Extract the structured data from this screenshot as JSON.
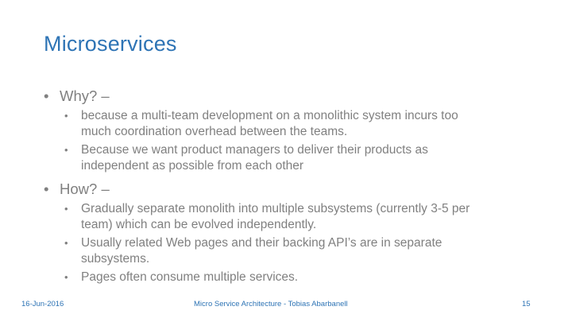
{
  "title": "Microservices",
  "sections": [
    {
      "heading": "Why? –",
      "items": [
        "because a multi-team development on a monolithic system incurs too much coordination overhead between the teams.",
        "Because we want product managers to deliver their products as independent as possible from each other"
      ]
    },
    {
      "heading": "How? –",
      "items": [
        "Gradually separate monolith into multiple subsystems (currently 3-5 per team) which can be evolved independently.",
        "Usually related Web pages and their backing API’s are in separate subsystems.",
        "Pages often consume multiple services."
      ]
    }
  ],
  "footer": {
    "date": "16-Jun-2016",
    "center": "Micro Service Architecture - Tobias Abarbanell",
    "page_number": "15"
  },
  "colors": {
    "title": "#2e74b5",
    "body_text": "#808080",
    "footer": "#2e74b5"
  }
}
